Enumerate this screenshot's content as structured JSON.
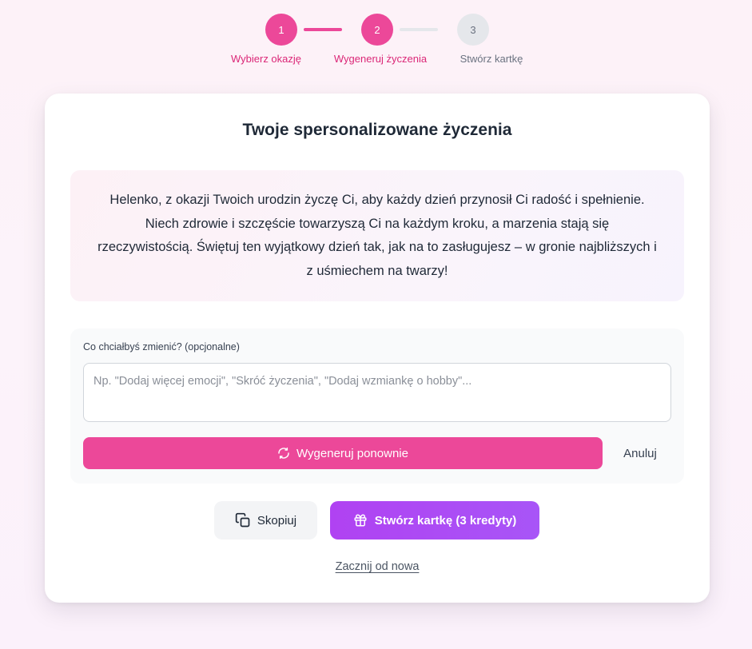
{
  "stepper": {
    "steps": [
      {
        "number": "1",
        "label": "Wybierz okazję",
        "state": "completed"
      },
      {
        "number": "2",
        "label": "Wygeneruj życzenia",
        "state": "current"
      },
      {
        "number": "3",
        "label": "Stwórz kartkę",
        "state": "upcoming"
      }
    ]
  },
  "card": {
    "title": "Twoje spersonalizowane życzenia",
    "wish_text": "Helenko, z okazji Twoich urodzin życzę Ci, aby każdy dzień przynosił Ci radość i spełnienie. Niech zdrowie i szczęście towarzyszą Ci na każdym kroku, a marzenia stają się rzeczywistością. Świętuj ten wyjątkowy dzień tak, jak na to zasługujesz – w gronie najbliższych i z uśmiechem na twarzy!"
  },
  "edit": {
    "label": "Co chciałbyś zmienić? (opcjonalne)",
    "value": "",
    "placeholder": "Np. \"Dodaj więcej emocji\", \"Skróć życzenia\", \"Dodaj wzmiankę o hobby\"...",
    "regenerate_label": "Wygeneruj ponownie",
    "regenerate_icon": "refresh-icon",
    "cancel_label": "Anuluj"
  },
  "actions": {
    "copy_label": "Skopiuj",
    "copy_icon": "copy-icon",
    "create_label": "Stwórz kartkę (3 kredyty)",
    "create_icon": "gift-icon",
    "restart_label": "Zacznij od nowa"
  },
  "colors": {
    "primary_pink": "#ec4899",
    "active_text_pink": "#db2777",
    "inactive_gray": "#e5e7eb",
    "create_purple": "#a855f7"
  }
}
